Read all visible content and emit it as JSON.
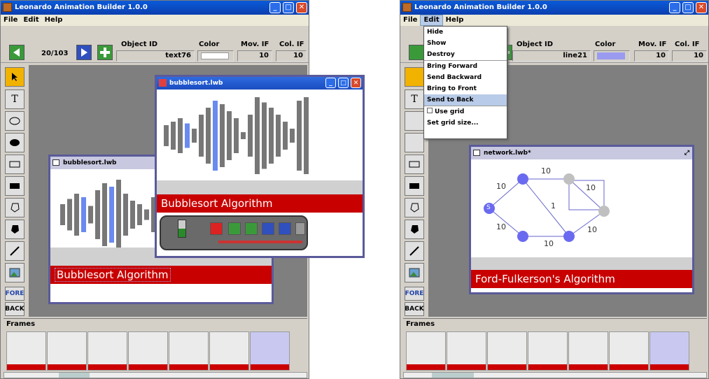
{
  "left": {
    "title": "Leonardo Animation Builder 1.0.0",
    "menu": [
      "File",
      "Edit",
      "Help"
    ],
    "counter": "20/103",
    "fields": {
      "object_id_label": "Object ID",
      "object_id": "text76",
      "color_label": "Color",
      "mov_if_label": "Mov. IF",
      "mov_if": "10",
      "col_if_label": "Col. IF",
      "col_if": "10",
      "color_value": "#ffffff"
    },
    "side": {
      "fore": "FORE",
      "back": "BACK"
    },
    "win1": {
      "title": "bubblesort.lwb",
      "caption": "Bubblesort Algorithm"
    },
    "win2": {
      "title": "bubblesort.lwb",
      "caption": "Bubblesort Algorithm"
    },
    "frames_label": "Frames"
  },
  "right": {
    "title": "Leonardo Animation Builder 1.0.0",
    "menu": [
      "File",
      "Edit",
      "Help"
    ],
    "fields": {
      "object_id_label": "Object ID",
      "object_id": "line21",
      "color_label": "Color",
      "mov_if_label": "Mov. IF",
      "mov_if": "10",
      "col_if_label": "Col. IF",
      "col_if": "10",
      "color_value": "#9a9af0"
    },
    "edit_menu": {
      "hide": "Hide",
      "show": "Show",
      "destroy": "Destroy",
      "bring_forward": "Bring Forward",
      "send_backward": "Send Backward",
      "bring_front": "Bring to Front",
      "send_back": "Send to Back",
      "use_grid": "Use grid",
      "set_grid": "Set grid size..."
    },
    "side": {
      "fore": "FORE",
      "back": "BACK"
    },
    "net": {
      "title": "network.lwb*",
      "caption": "Ford-Fulkerson's Algorithm",
      "s": "S",
      "w": [
        "10",
        "10",
        "10",
        "1",
        "10",
        "10",
        "10",
        "10"
      ]
    },
    "frames_label": "Frames"
  }
}
